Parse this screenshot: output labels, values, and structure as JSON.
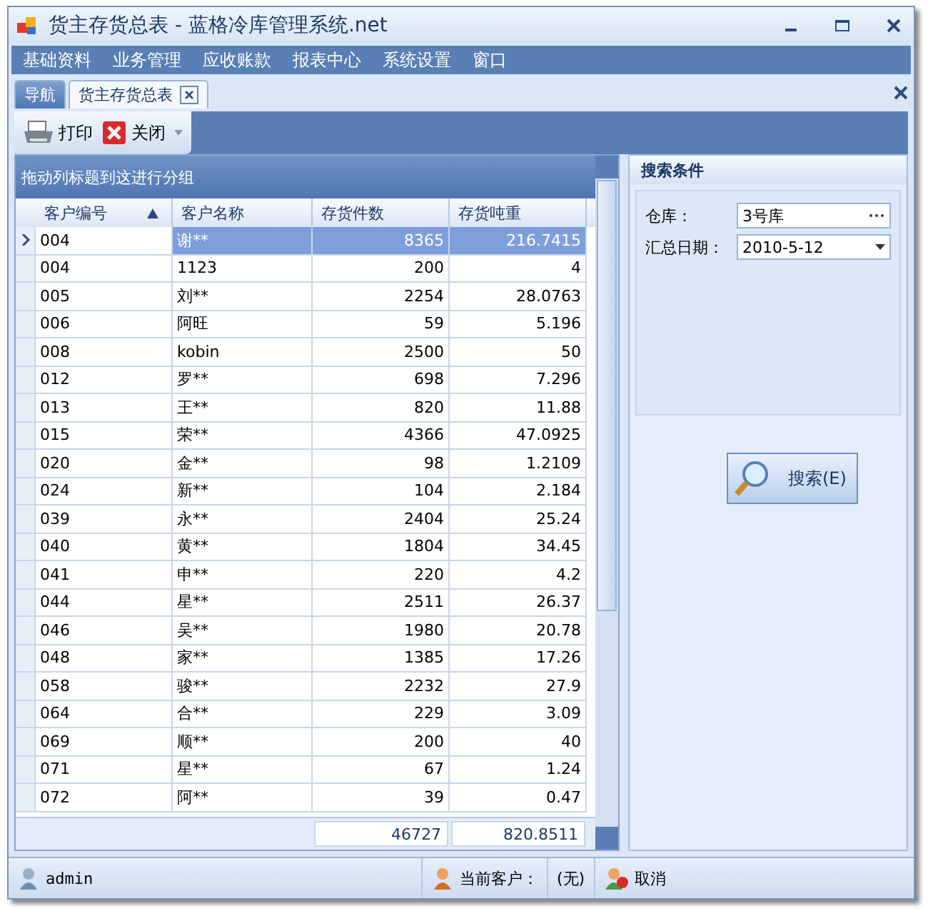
{
  "window": {
    "title": "货主存货总表 - 蓝格冷库管理系统.net"
  },
  "menu": [
    "基础资料",
    "业务管理",
    "应收账款",
    "报表中心",
    "系统设置",
    "窗口"
  ],
  "tabs": [
    {
      "label": "导航",
      "selected": false
    },
    {
      "label": "货主存货总表",
      "selected": true
    }
  ],
  "toolbar": [
    {
      "label": "打印",
      "kind": "print"
    },
    {
      "label": "关闭",
      "kind": "close"
    }
  ],
  "grid": {
    "group_hint": "拖动列标题到这进行分组",
    "columns": [
      {
        "label": "客户编号",
        "sorted": true
      },
      {
        "label": "客户名称",
        "sorted": false
      },
      {
        "label": "存货件数",
        "sorted": false
      },
      {
        "label": "存货吨重",
        "sorted": false
      }
    ],
    "rows": [
      {
        "cells": [
          "004",
          "谢**",
          "8365",
          "216.7415"
        ],
        "selected": true
      },
      {
        "cells": [
          "004",
          "1123",
          "200",
          "4"
        ],
        "selected": false
      },
      {
        "cells": [
          "005",
          "刘**",
          "2254",
          "28.0763"
        ],
        "selected": false
      },
      {
        "cells": [
          "006",
          "阿旺",
          "59",
          "5.196"
        ],
        "selected": false
      },
      {
        "cells": [
          "008",
          "kobin",
          "2500",
          "50"
        ],
        "selected": false
      },
      {
        "cells": [
          "012",
          "罗**",
          "698",
          "7.296"
        ],
        "selected": false
      },
      {
        "cells": [
          "013",
          "王**",
          "820",
          "11.88"
        ],
        "selected": false
      },
      {
        "cells": [
          "015",
          "荣**",
          "4366",
          "47.0925"
        ],
        "selected": false
      },
      {
        "cells": [
          "020",
          "金**",
          "98",
          "1.2109"
        ],
        "selected": false
      },
      {
        "cells": [
          "024",
          "新**",
          "104",
          "2.184"
        ],
        "selected": false
      },
      {
        "cells": [
          "039",
          "永**",
          "2404",
          "25.24"
        ],
        "selected": false
      },
      {
        "cells": [
          "040",
          "黄**",
          "1804",
          "34.45"
        ],
        "selected": false
      },
      {
        "cells": [
          "041",
          "申**",
          "220",
          "4.2"
        ],
        "selected": false
      },
      {
        "cells": [
          "044",
          "星**",
          "2511",
          "26.37"
        ],
        "selected": false
      },
      {
        "cells": [
          "046",
          "吴**",
          "1980",
          "20.78"
        ],
        "selected": false
      },
      {
        "cells": [
          "048",
          "家**",
          "1385",
          "17.26"
        ],
        "selected": false
      },
      {
        "cells": [
          "058",
          "骏**",
          "2232",
          "27.9"
        ],
        "selected": false
      },
      {
        "cells": [
          "064",
          "合**",
          "229",
          "3.09"
        ],
        "selected": false
      },
      {
        "cells": [
          "069",
          "顺**",
          "200",
          "40"
        ],
        "selected": false
      },
      {
        "cells": [
          "071",
          "星**",
          "67",
          "1.24"
        ],
        "selected": false
      },
      {
        "cells": [
          "072",
          "阿**",
          "39",
          "0.47"
        ],
        "selected": false
      }
    ],
    "totals": [
      "46727",
      "820.8511"
    ]
  },
  "search_panel": {
    "title": "搜索条件",
    "fields": [
      {
        "label": "仓库：",
        "value": "3号库",
        "kind": "picker"
      },
      {
        "label": "汇总日期：",
        "value": "2010-5-12",
        "kind": "dropdown"
      }
    ],
    "button": "搜索(E)"
  },
  "status_bar": {
    "user": "admin",
    "customer_label": "当前客户：",
    "customer": "(无)",
    "cancel": "取消"
  }
}
